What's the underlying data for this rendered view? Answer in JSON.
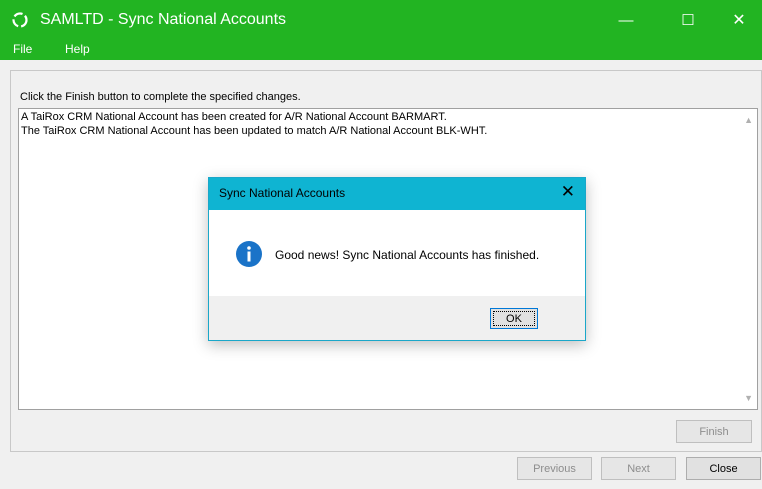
{
  "window": {
    "title": "SAMLTD - Sync National Accounts",
    "accent_color": "#22b422",
    "controls": {
      "minimize": "—",
      "maximize": "☐",
      "close": "✕"
    }
  },
  "menu": {
    "items": [
      "File",
      "Help"
    ]
  },
  "main": {
    "instruction": "Click the Finish button to complete the specified changes.",
    "log_lines": [
      "A TaiRox CRM National Account has been created for A/R National Account BARMART.",
      "The TaiRox CRM National Account has been updated to match A/R National Account BLK-WHT."
    ],
    "finish_label": "Finish"
  },
  "footer": {
    "previous_label": "Previous",
    "next_label": "Next",
    "close_label": "Close"
  },
  "dialog": {
    "title": "Sync National Accounts",
    "close_glyph": "✕",
    "message": "Good news! Sync National Accounts has finished.",
    "ok_label": "OK",
    "title_color": "#0fb4d2",
    "icon": "info-icon"
  }
}
